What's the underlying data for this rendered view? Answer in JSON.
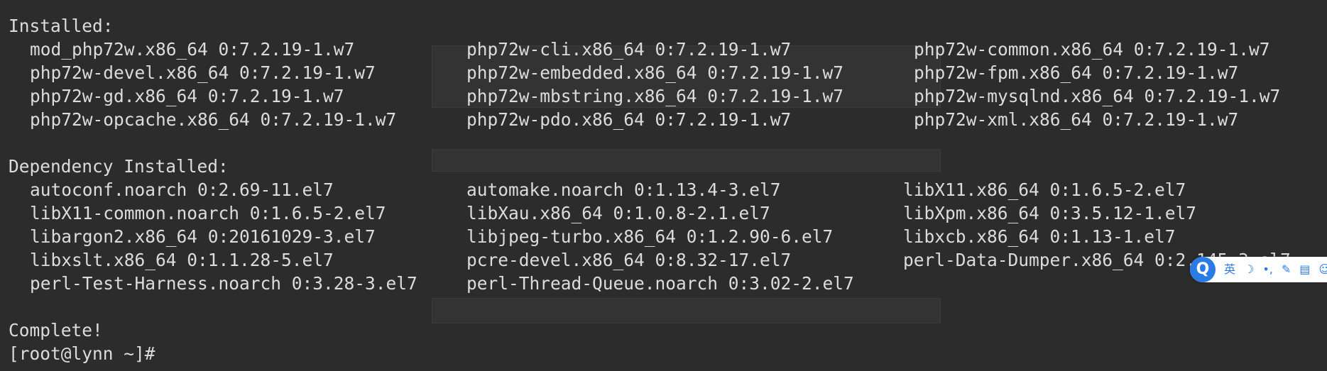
{
  "installed": {
    "header": "Installed:",
    "rows": [
      [
        "mod_php72w.x86_64 0:7.2.19-1.w7",
        "php72w-cli.x86_64 0:7.2.19-1.w7",
        "php72w-common.x86_64 0:7.2.19-1.w7"
      ],
      [
        "php72w-devel.x86_64 0:7.2.19-1.w7",
        "php72w-embedded.x86_64 0:7.2.19-1.w7",
        "php72w-fpm.x86_64 0:7.2.19-1.w7"
      ],
      [
        "php72w-gd.x86_64 0:7.2.19-1.w7",
        "php72w-mbstring.x86_64 0:7.2.19-1.w7",
        "php72w-mysqlnd.x86_64 0:7.2.19-1.w7"
      ],
      [
        "php72w-opcache.x86_64 0:7.2.19-1.w7",
        "php72w-pdo.x86_64 0:7.2.19-1.w7",
        "php72w-xml.x86_64 0:7.2.19-1.w7"
      ]
    ]
  },
  "dependency_installed": {
    "header": "Dependency Installed:",
    "rows": [
      [
        "autoconf.noarch 0:2.69-11.el7",
        "automake.noarch 0:1.13.4-3.el7",
        "libX11.x86_64 0:1.6.5-2.el7"
      ],
      [
        "libX11-common.noarch 0:1.6.5-2.el7",
        "libXau.x86_64 0:1.0.8-2.1.el7",
        "libXpm.x86_64 0:3.5.12-1.el7"
      ],
      [
        "libargon2.x86_64 0:20161029-3.el7",
        "libjpeg-turbo.x86_64 0:1.2.90-6.el7",
        "libxcb.x86_64 0:1.13-1.el7"
      ],
      [
        "libxslt.x86_64 0:1.1.28-5.el7",
        "pcre-devel.x86_64 0:8.32-17.el7",
        "perl-Data-Dumper.x86_64 0:2.145-3.el7"
      ],
      [
        "perl-Test-Harness.noarch 0:3.28-3.el7",
        "perl-Thread-Queue.noarch 0:3.02-2.el7",
        ""
      ]
    ]
  },
  "complete_text": "Complete!",
  "prompt": "[root@lynn ~]# ",
  "ime": {
    "logo": "Q",
    "lang": "英",
    "tools": [
      "☽",
      "•,",
      "✎",
      "▤",
      "☺"
    ]
  }
}
